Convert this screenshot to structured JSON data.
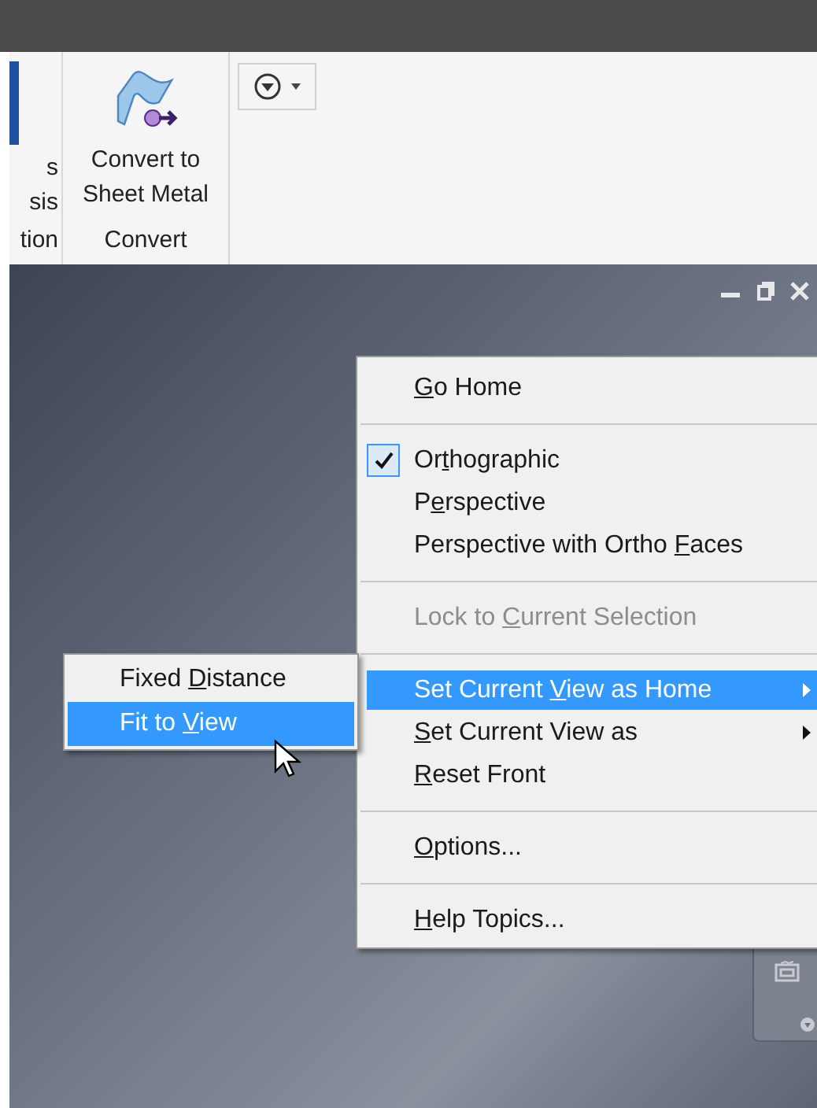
{
  "ribbon": {
    "panels": [
      {
        "kind": "partial",
        "lines": [
          "s",
          "sis"
        ],
        "title": "tion"
      },
      {
        "kind": "tool",
        "lines": [
          "Convert to",
          "Sheet Metal"
        ],
        "title": "Convert"
      }
    ],
    "dropdown": {
      "expanded": false
    }
  },
  "context_menu": {
    "items": [
      {
        "kind": "item",
        "label": {
          "key": "G",
          "post": "o Home"
        },
        "checked": false,
        "disabled": false,
        "selected": false,
        "submenu": false
      },
      {
        "kind": "separator"
      },
      {
        "kind": "item",
        "label": {
          "pre": "Or",
          "key": "t",
          "post": "hographic"
        },
        "checked": true,
        "disabled": false,
        "selected": false,
        "submenu": false
      },
      {
        "kind": "item",
        "label": {
          "pre": "P",
          "key": "e",
          "post": "rspective"
        },
        "checked": false,
        "disabled": false,
        "selected": false,
        "submenu": false
      },
      {
        "kind": "item",
        "label": {
          "pre": "Perspective with Ortho ",
          "key": "F",
          "post": "aces"
        },
        "checked": false,
        "disabled": false,
        "selected": false,
        "submenu": false
      },
      {
        "kind": "separator"
      },
      {
        "kind": "item",
        "label": {
          "pre": "Lock to ",
          "key": "C",
          "post": "urrent Selection"
        },
        "checked": false,
        "disabled": true,
        "selected": false,
        "submenu": false
      },
      {
        "kind": "separator"
      },
      {
        "kind": "item",
        "label": {
          "pre": "Set Current ",
          "key": "V",
          "post": "iew as Home"
        },
        "checked": false,
        "disabled": false,
        "selected": true,
        "submenu": true
      },
      {
        "kind": "item",
        "label": {
          "key": "S",
          "post": "et Current View as"
        },
        "checked": false,
        "disabled": false,
        "selected": false,
        "submenu": true
      },
      {
        "kind": "item",
        "label": {
          "key": "R",
          "post": "eset Front"
        },
        "checked": false,
        "disabled": false,
        "selected": false,
        "submenu": false
      },
      {
        "kind": "separator"
      },
      {
        "kind": "item",
        "label": {
          "key": "O",
          "post": "ptions..."
        },
        "checked": false,
        "disabled": false,
        "selected": false,
        "submenu": false
      },
      {
        "kind": "separator"
      },
      {
        "kind": "item",
        "label": {
          "key": "H",
          "post": "elp Topics..."
        },
        "checked": false,
        "disabled": false,
        "selected": false,
        "submenu": false
      }
    ]
  },
  "submenu": {
    "items": [
      {
        "label": {
          "pre": "Fixed ",
          "key": "D",
          "post": "istance"
        },
        "selected": false
      },
      {
        "label": {
          "pre": "Fit to ",
          "key": "V",
          "post": "iew"
        },
        "selected": true
      }
    ]
  }
}
